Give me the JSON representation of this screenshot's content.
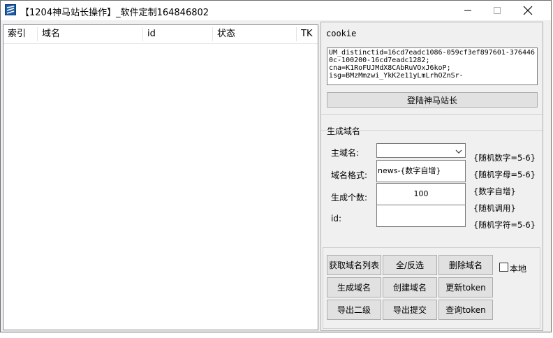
{
  "window": {
    "title": "【1204神马站长操作】_软件定制164846802",
    "controls": [
      "minimize-icon",
      "maximize-icon",
      "close-icon"
    ]
  },
  "listview": {
    "columns": [
      "索引",
      "域名",
      "id",
      "状态",
      "TK"
    ],
    "rows": []
  },
  "cookie": {
    "label": "cookie",
    "value": "UM_distinctid=16cd7eadc1086-059cf3ef897601-3764460c-100200-16cd7eadc1282;\ncna=K1RoFUJMdX8CAbRuVOxJ6koP;\nisg=BMzMmzwi_YkK2e11yLmLrhOZnSr-"
  },
  "login_button": "登陆神马站长",
  "generate": {
    "group_label": "生成域名",
    "main_domain_label": "主域名:",
    "main_domain_value": "",
    "format_label": "域名格式:",
    "format_value": "news-{数字自增}",
    "count_label": "生成个数:",
    "count_value": "100",
    "id_label": "id:",
    "id_value": "",
    "hints": [
      "{随机数字=5-6}",
      "{随机字母=5-6}",
      "{数字自增}",
      "{随机调用}",
      "{随机字符=5-6}"
    ]
  },
  "buttons": {
    "get_list": "获取域名列表",
    "select_toggle": "全/反选",
    "delete_domain": "删除域名",
    "local_label": "本地",
    "local_checked": false,
    "gen_domain": "生成域名",
    "create_domain": "创建域名",
    "update_token": "更新token",
    "export_sub": "导出二级",
    "export_submit": "导出提交",
    "query_token": "查询token"
  }
}
